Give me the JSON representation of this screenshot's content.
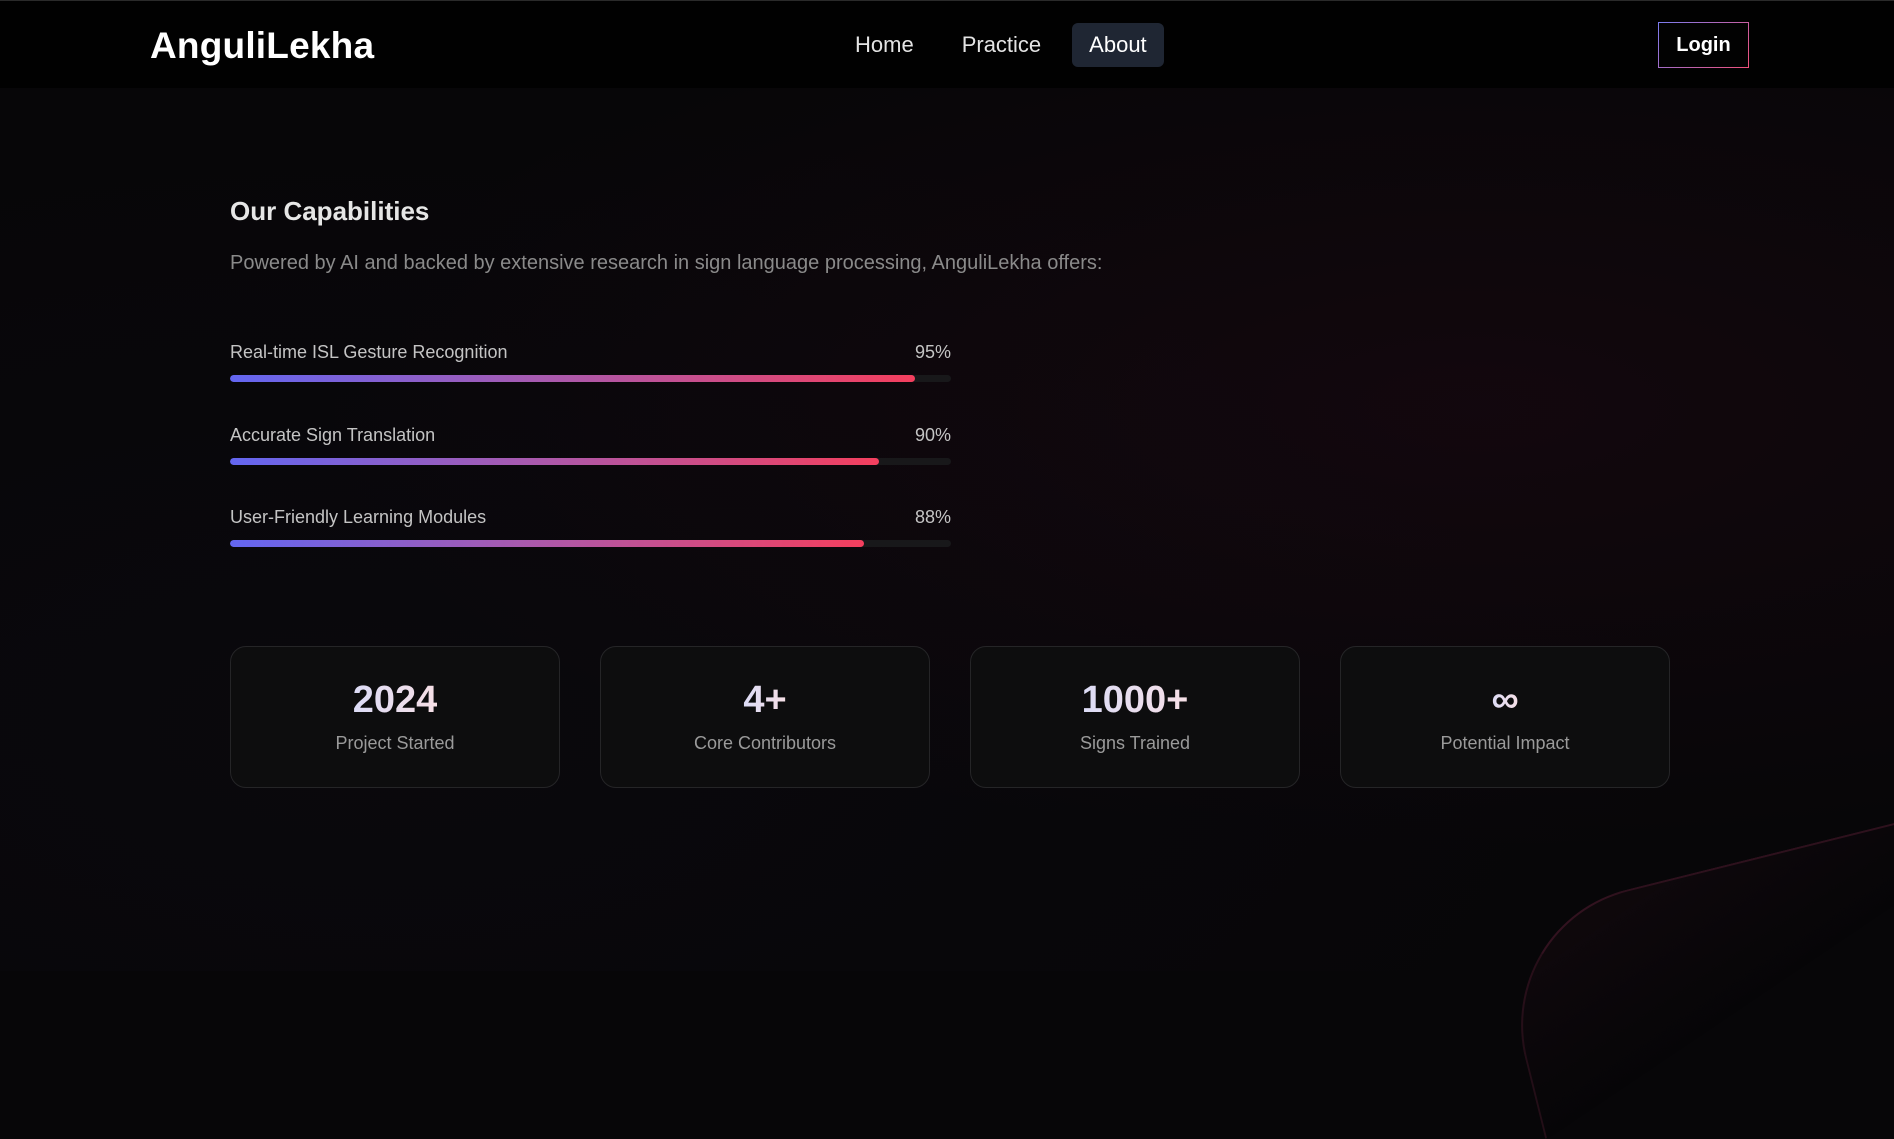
{
  "header": {
    "brand": "AnguliLekha",
    "nav": [
      {
        "label": "Home",
        "active": false
      },
      {
        "label": "Practice",
        "active": false
      },
      {
        "label": "About",
        "active": true
      }
    ],
    "login_label": "Login"
  },
  "capabilities": {
    "title": "Our Capabilities",
    "description": "Powered by AI and backed by extensive research in sign language processing, AnguliLekha offers:",
    "skills": [
      {
        "label": "Real-time ISL Gesture Recognition",
        "percent_text": "95%",
        "value": 95
      },
      {
        "label": "Accurate Sign Translation",
        "percent_text": "90%",
        "value": 90
      },
      {
        "label": "User-Friendly Learning Modules",
        "percent_text": "88%",
        "value": 88
      }
    ]
  },
  "stats": [
    {
      "value": "2024",
      "label": "Project Started"
    },
    {
      "value": "4+",
      "label": "Core Contributors"
    },
    {
      "value": "1000+",
      "label": "Signs Trained"
    },
    {
      "value": "∞",
      "label": "Potential Impact"
    }
  ],
  "colors": {
    "background": "#070608",
    "navbar": "#010101",
    "active_tab": "#1f2633",
    "gradient_start": "#6366f1",
    "gradient_end": "#f43f5e"
  }
}
